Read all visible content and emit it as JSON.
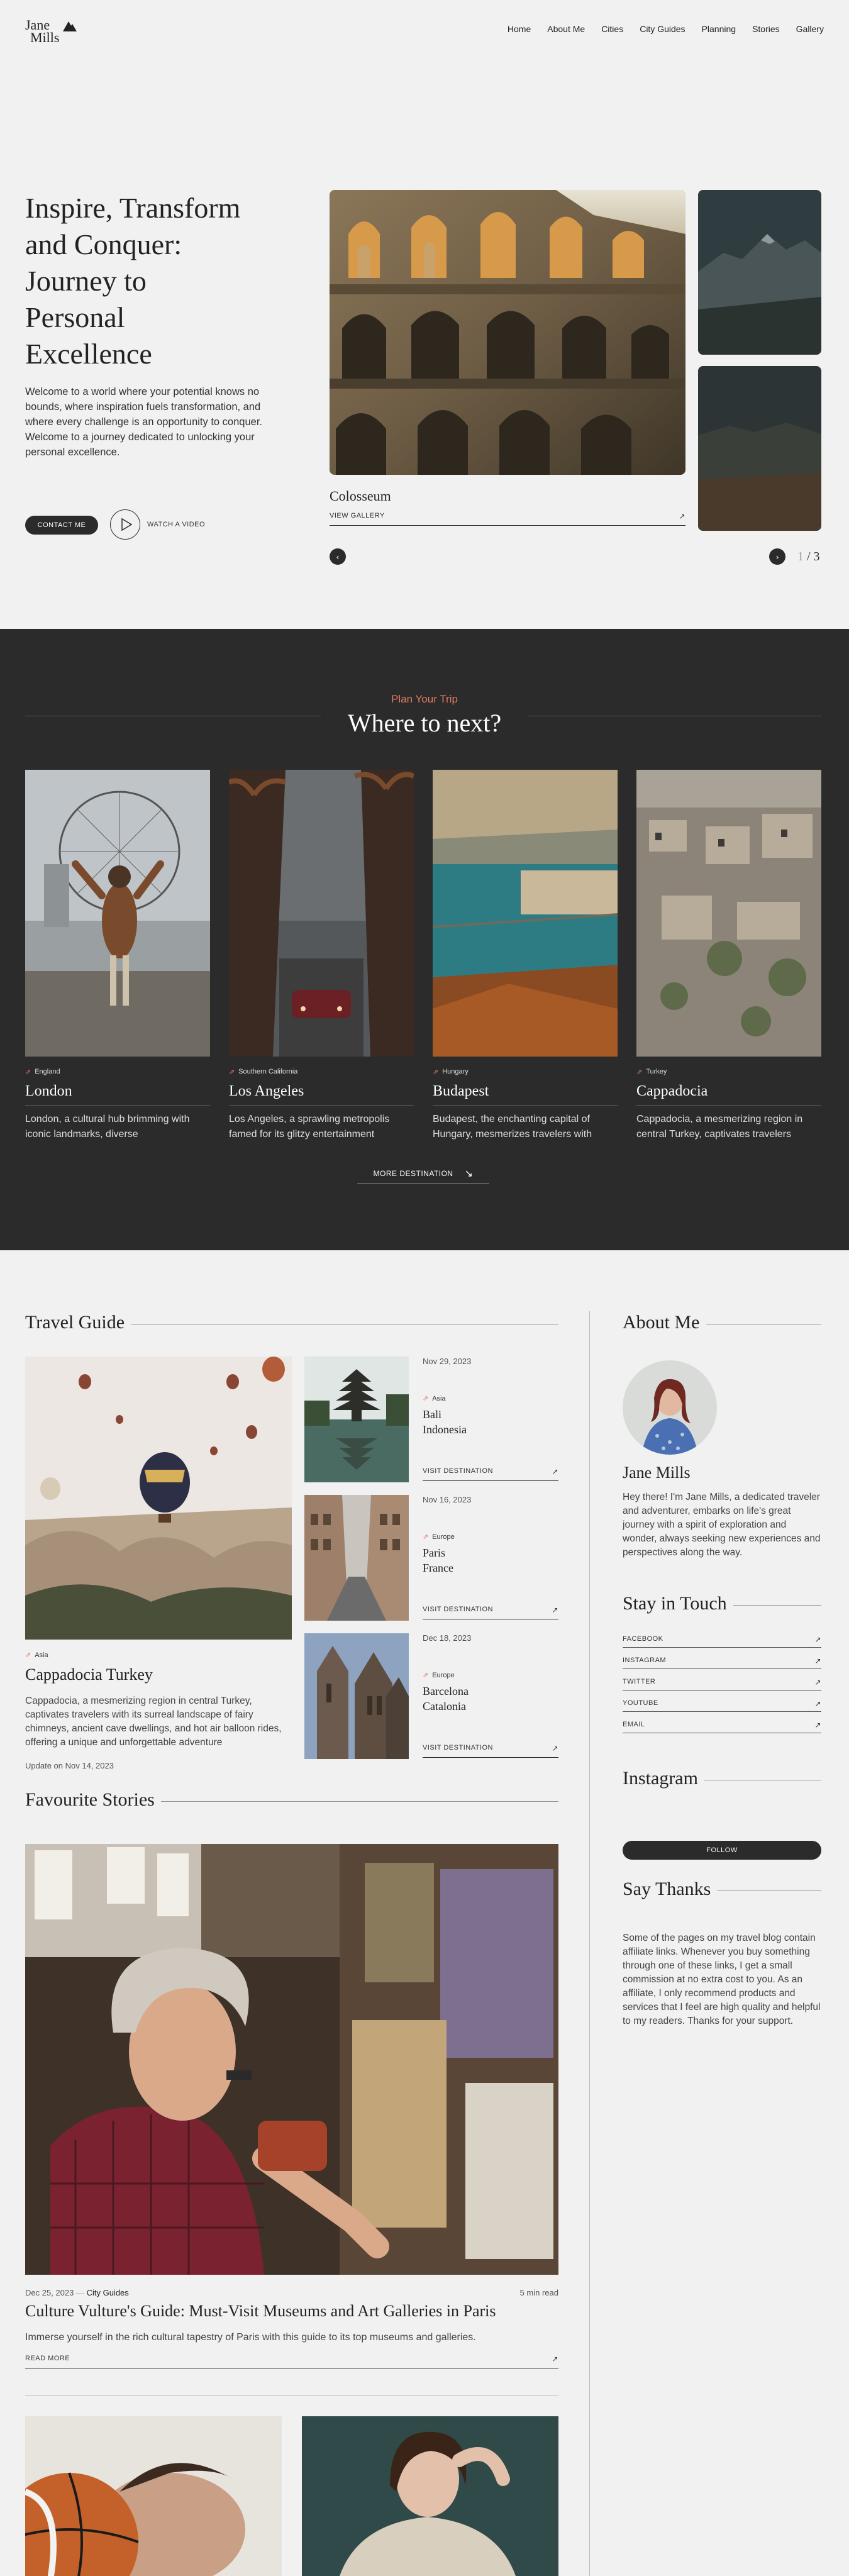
{
  "header": {
    "logo_line1": "Jane",
    "logo_line2": "Mills",
    "nav": [
      "Home",
      "About Me",
      "Cities",
      "City Guides",
      "Planning",
      "Stories",
      "Gallery"
    ]
  },
  "hero": {
    "title_lines": [
      "Inspire, Transform",
      "and Conquer:",
      "Journey to",
      "Personal",
      "Excellence"
    ],
    "text": "Welcome to a world where your potential knows no bounds, where inspiration fuels transformation, and where every challenge is an opportunity to conquer. Welcome to a journey dedicated to unlocking your personal excellence.",
    "contact_label": "CONTACT ME",
    "watch_label": "WATCH A VIDEO",
    "slide_caption": "Colosseum",
    "gallery_label": "VIEW GALLERY",
    "counter_current": "1",
    "counter_total": "/ 3"
  },
  "destinations": {
    "eyebrow": "Plan Your Trip",
    "title": "Where to next?",
    "cards": [
      {
        "region": "England",
        "name": "London",
        "desc": "London, a cultural hub brimming with iconic landmarks, diverse"
      },
      {
        "region": "Southern California",
        "name": "Los Angeles",
        "desc": "Los Angeles, a sprawling metropolis famed for its glitzy entertainment"
      },
      {
        "region": "Hungary",
        "name": "Budapest",
        "desc": "Budapest, the enchanting capital of Hungary, mesmerizes travelers with"
      },
      {
        "region": "Turkey",
        "name": "Cappadocia",
        "desc": "Cappadocia, a mesmerizing region in central Turkey, captivates travelers"
      }
    ],
    "more_label": "MORE DESTINATION"
  },
  "travel_guide": {
    "heading": "Travel Guide",
    "featured": {
      "region": "Asia",
      "name": "Cappadocia Turkey",
      "desc": "Cappadocia, a mesmerizing region in central Turkey, captivates travelers with its surreal landscape of fairy chimneys, ancient cave dwellings, and hot air balloon rides, offering a unique and unforgettable adventure",
      "updated": "Update on Nov 14, 2023"
    },
    "items": [
      {
        "date": "Nov 29, 2023",
        "region": "Asia",
        "city_line1": "Bali",
        "city_line2": "Indonesia",
        "visit": "VISIT DESTINATION"
      },
      {
        "date": "Nov 16, 2023",
        "region": "Europe",
        "city_line1": "Paris",
        "city_line2": "France",
        "visit": "VISIT DESTINATION"
      },
      {
        "date": "Dec 18, 2023",
        "region": "Europe",
        "city_line1": "Barcelona",
        "city_line2": "Catalonia",
        "visit": "VISIT DESTINATION"
      }
    ]
  },
  "sidebar": {
    "about_heading": "About Me",
    "about_name": "Jane Mills",
    "about_text": "Hey there! I'm Jane Mills, a dedicated traveler and adventurer, embarks on life's great journey with a spirit of exploration and wonder, always seeking new experiences and perspectives along the way.",
    "stay_heading": "Stay in Touch",
    "socials": [
      "FACEBOOK",
      "INSTAGRAM",
      "TWITTER",
      "YOUTUBE",
      "EMAIL"
    ],
    "instagram_heading": "Instagram",
    "follow_label": "FOLLOW",
    "thanks_heading": "Say Thanks",
    "thanks_text": "Some of the pages on my travel blog contain affiliate links. Whenever you buy something through one of these links, I get a small commission at no extra cost to you. As an affiliate, I only recommend products and services that I feel are high quality and helpful to my readers. Thanks for your support."
  },
  "favourites": {
    "heading": "Favourite Stories",
    "date": "Dec 25, 2023",
    "category": "City Guides",
    "read_time": "5 min read",
    "title": "Culture Vulture's Guide: Must-Visit Museums and Art Galleries in Paris",
    "desc": "Immerse yourself in the rich cultural tapestry of Paris with this guide to its top museums and galleries.",
    "read_more": "READ MORE"
  },
  "colors": {
    "dark": "#2b2b2b",
    "accent": "#e07a5f",
    "bg": "#f1f1f1"
  }
}
